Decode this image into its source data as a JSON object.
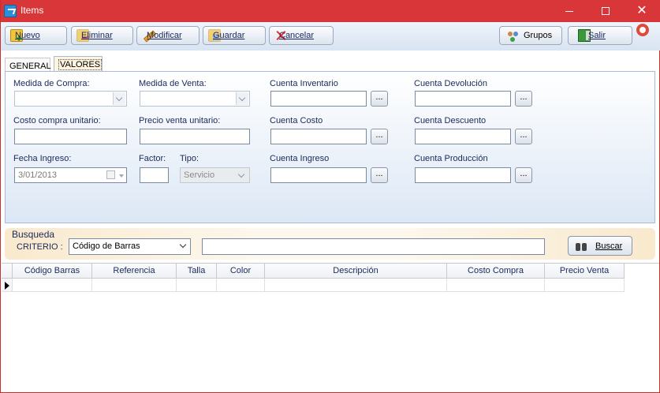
{
  "window": {
    "title": "Items"
  },
  "toolbar": {
    "nuevo": "Nuevo",
    "eliminar": "Eliminar",
    "modificar": "Modificar",
    "guardar": "Guardar",
    "cancelar": "Cancelar",
    "grupos": "Grupos",
    "salir": "Salir"
  },
  "tabs": {
    "general": "GENERAL",
    "valores": "VALORES"
  },
  "form": {
    "medida_compra_label": "Medida de Compra:",
    "medida_venta_label": "Medida de Venta:",
    "cuenta_inventario_label": "Cuenta Inventario",
    "cuenta_devolucion_label": "Cuenta Devolución",
    "costo_compra_label": "Costo compra unitario:",
    "precio_venta_label": "Precio venta unitario:",
    "cuenta_costo_label": "Cuenta Costo",
    "cuenta_descuento_label": "Cuenta Descuento",
    "fecha_ingreso_label": "Fecha Ingreso:",
    "fecha_ingreso_value": "3/01/2013",
    "factor_label": "Factor:",
    "tipo_label": "Tipo:",
    "tipo_value": "Servicio",
    "cuenta_ingreso_label": "Cuenta Ingreso",
    "cuenta_produccion_label": "Cuenta Producción",
    "dots": "..."
  },
  "search": {
    "title": "Busqueda",
    "criterio_label": "CRITERIO :",
    "criterio_value": "Código de Barras",
    "buscar": "Buscar"
  },
  "grid": {
    "columns": [
      "Código Barras",
      "Referencia",
      "Talla",
      "Color",
      "Descripción",
      "Costo Compra",
      "Precio Venta"
    ]
  }
}
